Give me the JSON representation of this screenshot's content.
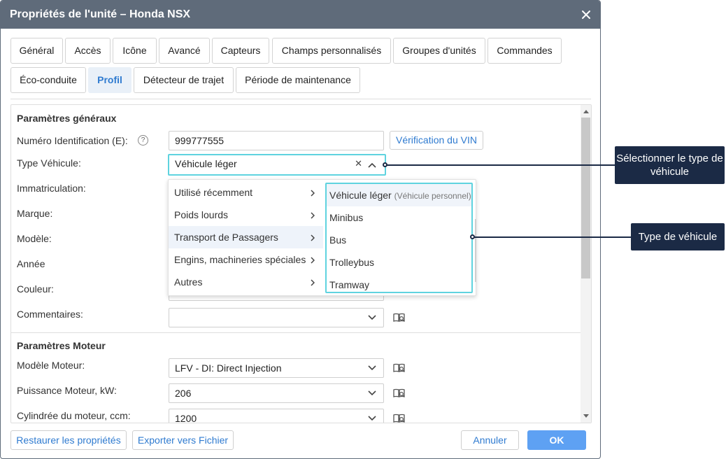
{
  "dialog": {
    "title": "Propriétés de l'unité – Honda NSX",
    "tabs_row1": [
      "Général",
      "Accès",
      "Icône",
      "Avancé",
      "Capteurs",
      "Champs personnalisés",
      "Groupes d'unités",
      "Commandes"
    ],
    "tabs_row2": [
      "Éco-conduite",
      "Profil",
      "Détecteur de trajet",
      "Période de maintenance"
    ],
    "active_tab": "Profil"
  },
  "general": {
    "title": "Paramètres généraux",
    "vin_label": "Numéro Identification (E):",
    "vin_value": "999777555",
    "vin_button": "Vérification du VIN",
    "help_glyph": "?",
    "type_label": "Type Véhicule:",
    "type_value": "Véhicule léger",
    "clear_glyph": "✕",
    "immat_label": "Immatriculation:",
    "marque_label": "Marque:",
    "modele_label": "Modèle:",
    "annee_label": "Année",
    "couleur_label": "Couleur:",
    "comment_label": "Commentaires:",
    "comment_value": ""
  },
  "engine": {
    "title": "Paramètres Moteur",
    "model_label": "Modèle Moteur:",
    "model_value": "LFV - DI: Direct Injection",
    "power_label": "Puissance Moteur, kW:",
    "power_value": "206",
    "displacement_label": "Cylindrée du moteur, ccm:",
    "displacement_value": "1200"
  },
  "menu": {
    "categories": [
      "Utilisé récemment",
      "Poids lourds",
      "Transport de Passagers",
      "Engins, machineries spéciales",
      "Autres"
    ],
    "hovered_index": 2,
    "sub_items": [
      {
        "label": "Véhicule léger",
        "hint": "(Véhicule personnel)"
      },
      {
        "label": "Minibus",
        "hint": ""
      },
      {
        "label": "Bus",
        "hint": ""
      },
      {
        "label": "Trolleybus",
        "hint": ""
      },
      {
        "label": "Tramway",
        "hint": ""
      }
    ]
  },
  "footer": {
    "restore": "Restaurer les propriétés",
    "export": "Exporter vers Fichier",
    "cancel": "Annuler",
    "ok": "OK"
  },
  "callouts": {
    "select_type": "Sélectionner le type de véhicule",
    "vehicle_type": "Type de véhicule"
  },
  "colors": {
    "titlebar": "#5f6b7a",
    "accent": "#2f7bd0",
    "focus": "#5fd3df",
    "primary_button": "#5ea1f3",
    "callout": "#1b2a45"
  }
}
